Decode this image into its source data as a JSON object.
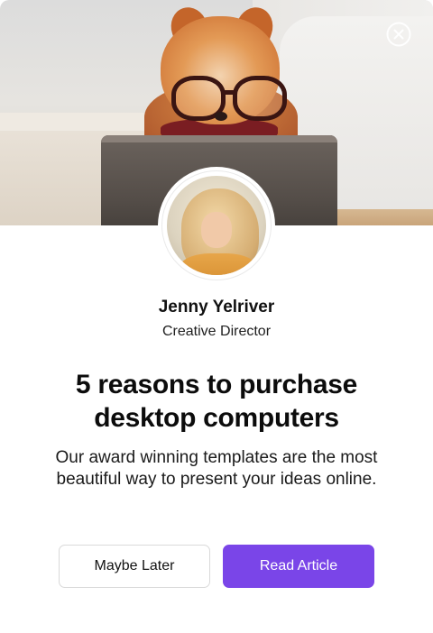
{
  "modal": {
    "close_icon": "close-circle-icon",
    "hero_image": "dog-with-glasses-and-tablet-photo",
    "author": {
      "avatar": "author-avatar-photo",
      "name": "Jenny Yelriver",
      "role": "Creative Director"
    },
    "headline": "5 reasons to purchase desktop computers",
    "description": "Our award winning templates are the most beautiful way to present your ideas online.",
    "actions": {
      "secondary_label": "Maybe Later",
      "primary_label": "Read Article"
    },
    "colors": {
      "primary": "#7a45e8",
      "text": "#111111",
      "border": "#d9d9d9"
    }
  }
}
